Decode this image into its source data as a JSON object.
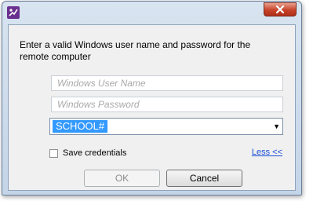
{
  "dialog": {
    "app_icon": "remote-desktop-icon",
    "close_icon": "close-x-icon",
    "close_label": "✕",
    "prompt": "Enter a valid Windows user name and password for the remote computer",
    "username": {
      "placeholder": "Windows User Name",
      "value": ""
    },
    "password": {
      "placeholder": "Windows Password",
      "value": ""
    },
    "domain": {
      "selected": "SCHOOL#"
    },
    "save_credentials": {
      "label": "Save credentials",
      "checked": false
    },
    "less_link": "Less <<",
    "ok_label": "OK",
    "ok_enabled": false,
    "cancel_label": "Cancel"
  }
}
